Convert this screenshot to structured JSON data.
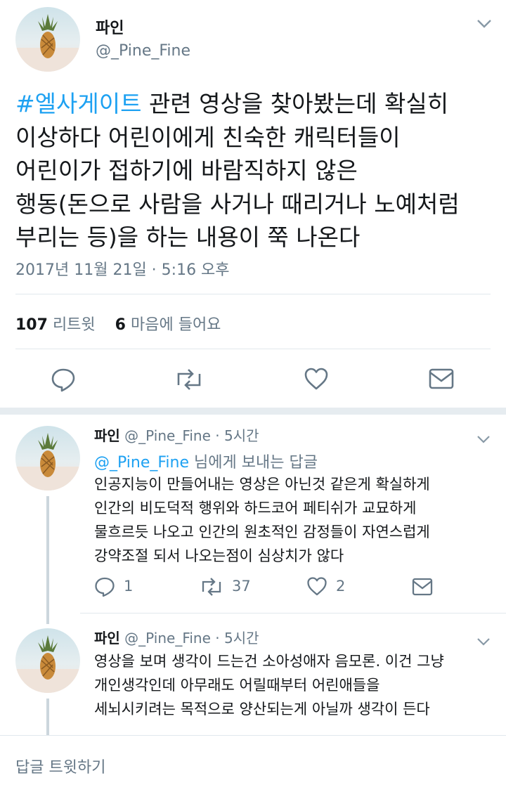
{
  "main": {
    "author_name": "파인",
    "author_handle": "@_Pine_Fine",
    "hashtag": "#엘사게이트",
    "text": " 관련 영상을 찾아봤는데 확실히\n이상하다 어린이에게 친숙한 캐릭터들이\n어린이가 접하기에 바람직하지 않은\n행동(돈으로 사람을 사거나 때리거나 노예처럼\n부리는 등)을 하는 내용이 쭉 나온다",
    "timestamp": "2017년 11월 21일 · 5:16 오후",
    "retweet_count": "107",
    "retweet_label": "리트윗",
    "like_count": "6",
    "like_label": "마음에 들어요"
  },
  "replies": [
    {
      "name": "파인",
      "handle": "@_Pine_Fine",
      "time": "· 5시간",
      "replying_mention": "@_Pine_Fine",
      "replying_suffix": " 님에게 보내는 답글",
      "text": "인공지능이 만들어내는 영상은 아닌것 같은게 확실하게\n인간의 비도덕적 행위와 하드코어 페티쉬가 교묘하게\n물흐르듯 나오고 인간의 원초적인 감정들이 자연스럽게\n강약조절 되서 나오는점이 심상치가 않다",
      "reply_count": "1",
      "retweet_count": "37",
      "like_count": "2"
    },
    {
      "name": "파인",
      "handle": "@_Pine_Fine",
      "time": "· 5시간",
      "text": "영상을 보며 생각이 드는건 소아성애자 음모론. 이건 그냥\n개인생각인데 아무래도 어릴때부터 어린애들을\n세뇌시키려는 목적으로 양산되는게 아닐까 생각이 든다"
    }
  ],
  "compose": {
    "placeholder": "답글 트윗하기"
  },
  "colors": {
    "accent": "#1da1f2",
    "muted": "#657786",
    "text": "#14171a",
    "divider": "#e1e8ed"
  }
}
